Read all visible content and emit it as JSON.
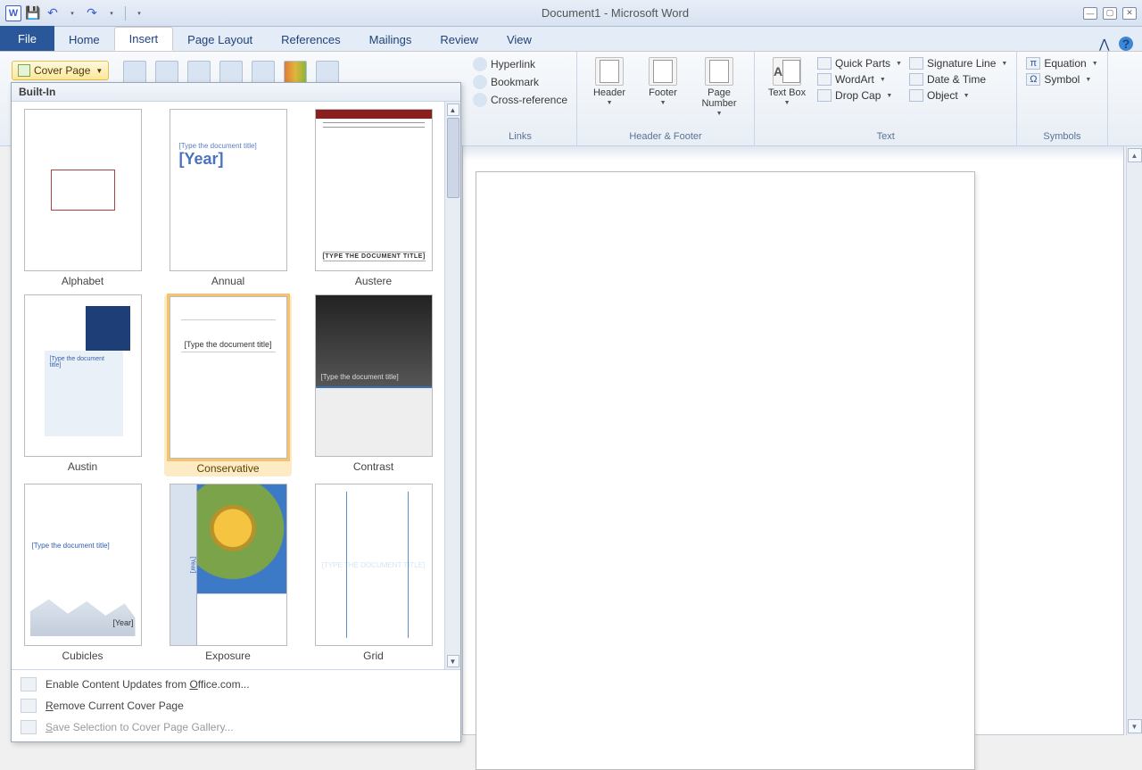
{
  "titlebar": {
    "app_icon_text": "W",
    "title": "Document1 - Microsoft Word"
  },
  "qat": {
    "save": "💾",
    "undo": "↶",
    "redo": "↷"
  },
  "tabs": {
    "file": "File",
    "home": "Home",
    "insert": "Insert",
    "page_layout": "Page Layout",
    "references": "References",
    "mailings": "Mailings",
    "review": "Review",
    "view": "View"
  },
  "ribbon": {
    "cover_page_btn": "Cover Page",
    "links": {
      "hyperlink": "Hyperlink",
      "bookmark": "Bookmark",
      "cross_reference": "Cross-reference",
      "group": "Links"
    },
    "hf": {
      "header": "Header",
      "footer": "Footer",
      "page_number": "Page Number",
      "group": "Header & Footer"
    },
    "text": {
      "text_box": "Text Box",
      "quick_parts": "Quick Parts",
      "wordart": "WordArt",
      "drop_cap": "Drop Cap",
      "signature_line": "Signature Line",
      "date_time": "Date & Time",
      "object": "Object",
      "group": "Text"
    },
    "symbols": {
      "equation": "Equation",
      "symbol": "Symbol",
      "group": "Symbols"
    }
  },
  "gallery": {
    "header": "Built-In",
    "items": [
      {
        "label": "Alphabet"
      },
      {
        "label": "Annual"
      },
      {
        "label": "Austere"
      },
      {
        "label": "Austin"
      },
      {
        "label": "Conservative"
      },
      {
        "label": "Contrast"
      },
      {
        "label": "Cubicles"
      },
      {
        "label": "Exposure"
      },
      {
        "label": "Grid"
      }
    ],
    "preview_strings": {
      "annual_year": "[Year]",
      "annual_small": "[Type the document title]",
      "austere_title": "[TYPE THE DOCUMENT TITLE]",
      "austin_title": "[Type the document title]",
      "conservative_title": "[Type the document title]",
      "contrast_title": "[Type the document title]",
      "cubicles_title": "[Type the document title]",
      "cubicles_year": "[Year]",
      "exposure_year": "[Year]",
      "grid_title": "[TYPE THE DOCUMENT TITLE]"
    },
    "footer": {
      "enable_updates": "Enable Content Updates from Office.com...",
      "remove": "Remove Current Cover Page",
      "save_selection": "Save Selection to Cover Page Gallery..."
    }
  }
}
